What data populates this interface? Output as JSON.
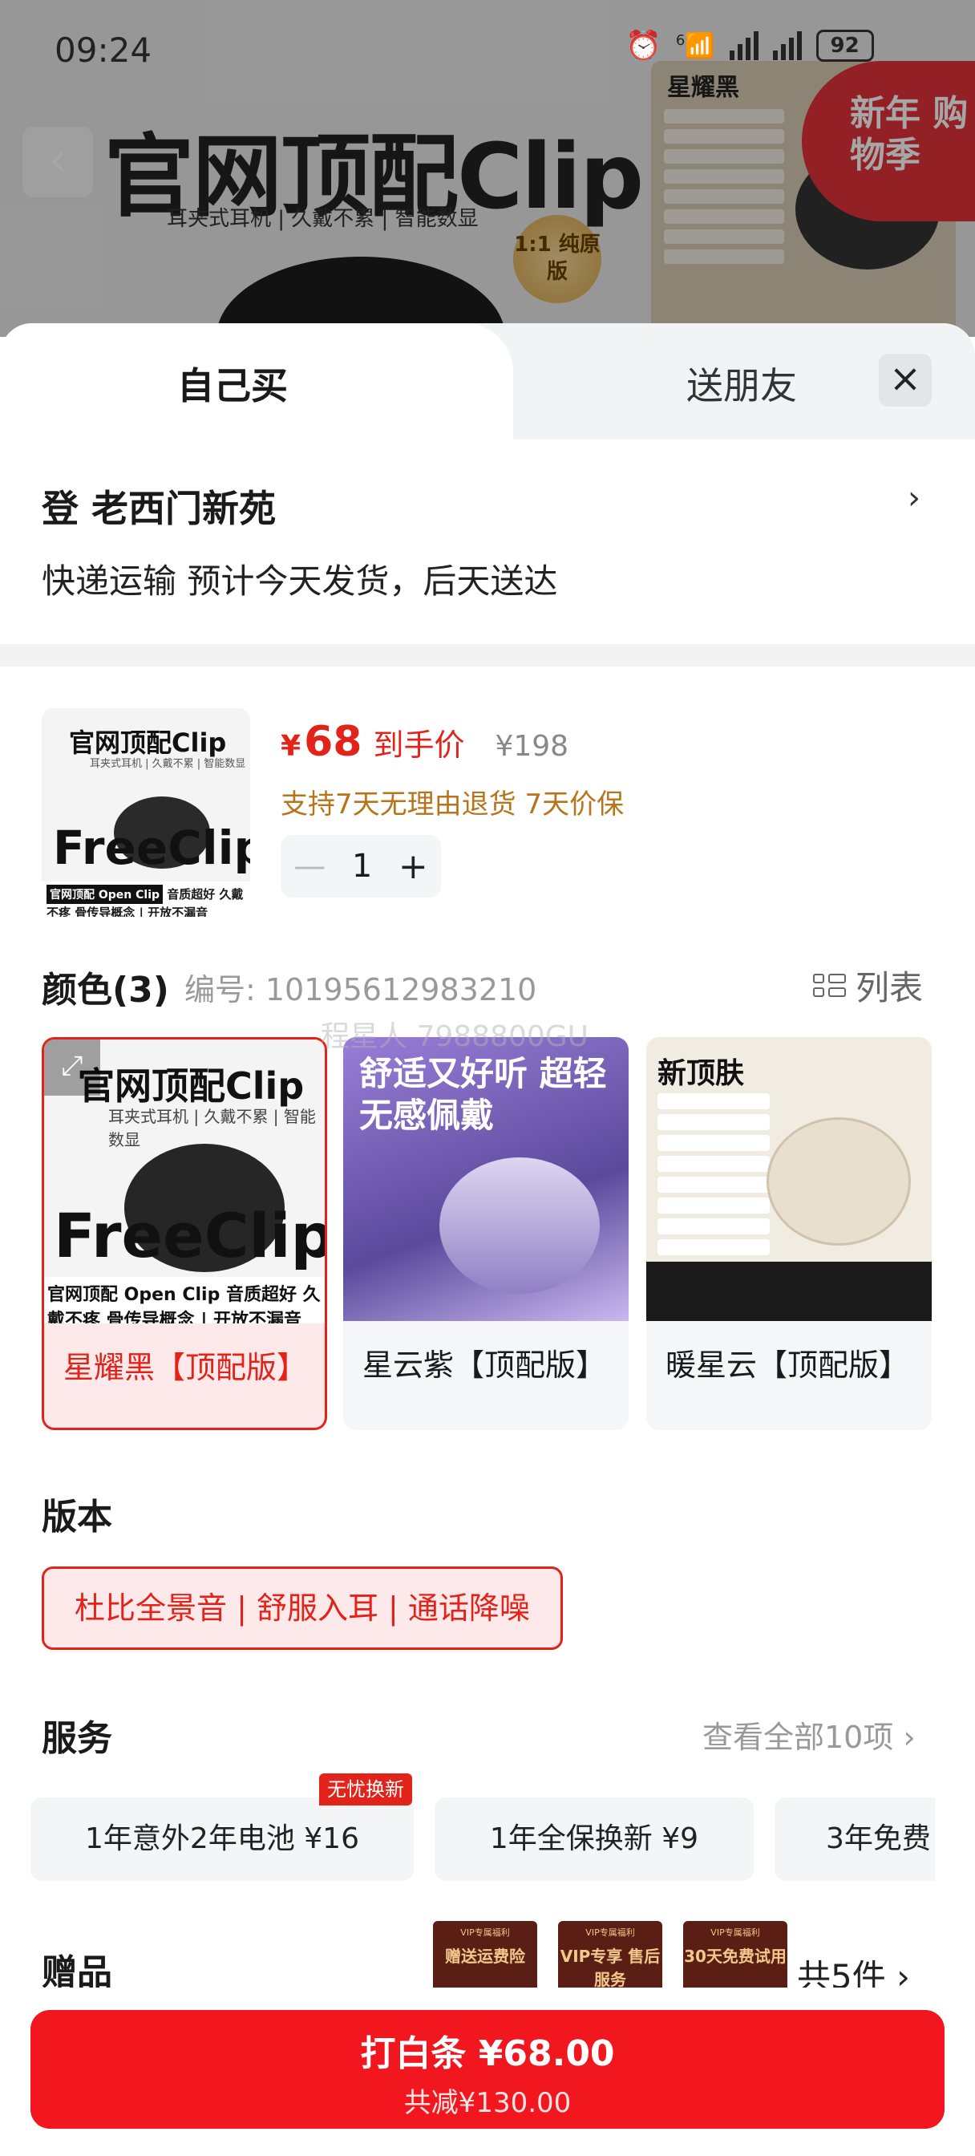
{
  "status_bar": {
    "time": "09:24",
    "network": "6",
    "battery": "92"
  },
  "background": {
    "title": "官网顶配Clip",
    "subtitle": "耳夹式耳机 | 久戴不累 | 智能数显",
    "seal": "1:1 纯原版",
    "thumb_title": "星耀黑",
    "promo": "新年 购物季"
  },
  "tabs": {
    "self": "自己买",
    "friend": "送朋友"
  },
  "address": {
    "text": "登  老西门新苑",
    "delivery": "快递运输 预计今天发货，后天送达"
  },
  "product": {
    "currency": "¥",
    "price": "68",
    "price_label": "到手价",
    "original_price": "¥198",
    "guarantee": "支持7天无理由退货  7天价保",
    "quantity": "1",
    "image_title": "官网顶配Clip",
    "image_subtitle": "耳夹式耳机 | 久戴不累 | 智能数显",
    "image_big": "FreeClip",
    "image_tag": "官网顶配 Open Clip",
    "image_foot": "音质超好 久戴不疼 骨传导概念 | 开放不漏音"
  },
  "color_section": {
    "title": "颜色(3)",
    "sku": "编号: 10195612983210",
    "list_label": "列表",
    "watermark": "程星人 7988800GU",
    "options": [
      {
        "label": "星耀黑【顶配版】",
        "selected": true,
        "img_title": "官网顶配Clip",
        "img_sub": "耳夹式耳机 | 久戴不累 | 智能数显",
        "img_big": "FreeClip",
        "img_foot": "官网顶配 Open Clip 音质超好 久戴不疼 骨传导概念 | 开放不漏音"
      },
      {
        "label": "星云紫【顶配版】",
        "selected": false,
        "img_title": "舒适又好听 超轻无感佩戴"
      },
      {
        "label": "暖星云【顶配版】",
        "selected": false,
        "img_title": "新顶肤"
      }
    ]
  },
  "version": {
    "title": "版本",
    "option": "杜比全景音 | 舒服入耳 | 通话降噪"
  },
  "service": {
    "title": "服务",
    "view_all": "查看全部10项",
    "badge": "无忧换新",
    "options": [
      "1年意外2年电池 ¥16",
      "1年全保换新 ¥9",
      "3年免费"
    ]
  },
  "gifts": {
    "title": "赠品",
    "items": [
      {
        "top": "VIP专属福利",
        "mid": "赠送运费险"
      },
      {
        "top": "VIP专属福利",
        "mid": "VIP专享 售后服务"
      },
      {
        "top": "VIP专属福利",
        "mid": "30天免费试用"
      }
    ],
    "count": "共5件"
  },
  "pay": {
    "main": "打白条 ¥68.00",
    "sub": "共减¥130.00"
  },
  "colors": {
    "accent": "#e2231a",
    "button": "#f2161f",
    "guarantee": "#b8741a"
  }
}
